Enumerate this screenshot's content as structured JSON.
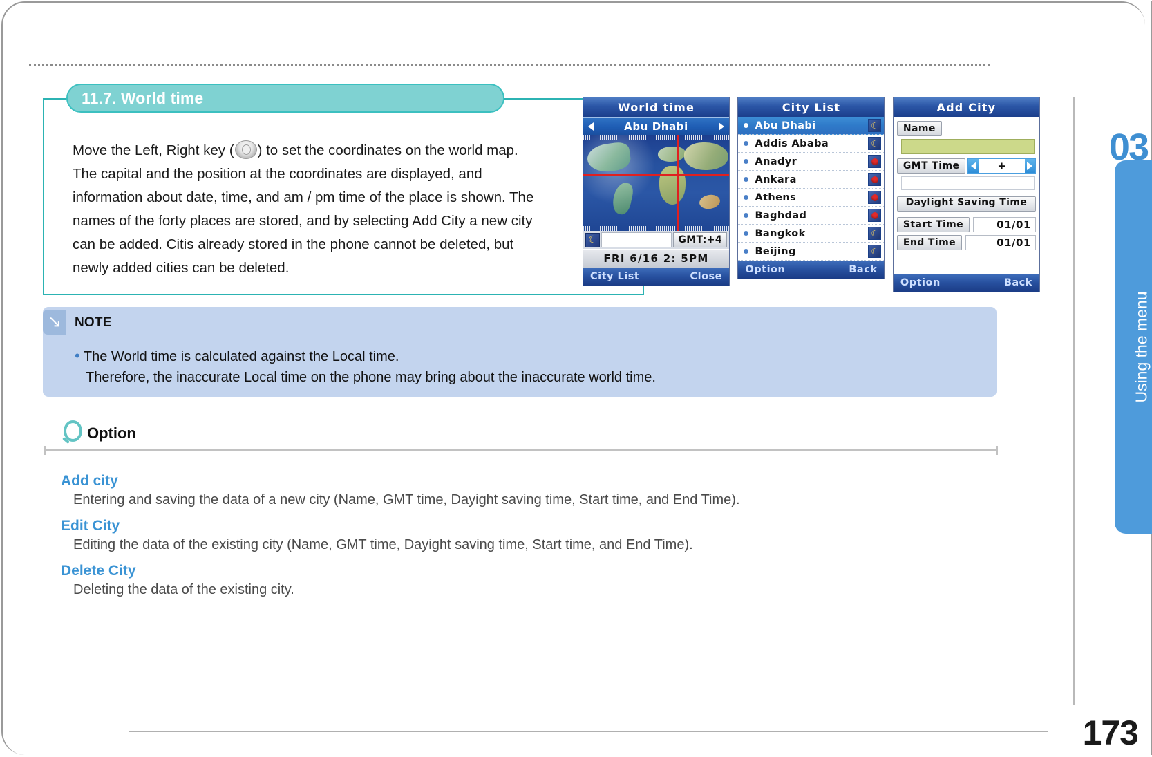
{
  "section": {
    "title": "11.7. World time",
    "body_before_key": "Move the Left, Right key (",
    "body_after_key": ") to set the coordinates on the world map. The capital and the position at the coordinates are displayed, and information about date, time, and am / pm time of the place is shown. The names of the forty places are stored, and by selecting Add City a new city can be added. Citis already stored in the phone cannot be deleted, but newly added cities can be deleted."
  },
  "screens": {
    "world_time": {
      "title": "World  time",
      "city": "Abu  Dhabi",
      "gmt": "GMT:+4",
      "date_line": "FRI   6/16   2: 5PM",
      "softkey_left": "City List",
      "softkey_right": "Close"
    },
    "city_list": {
      "title": "City  List",
      "items": [
        {
          "name": "Abu  Dhabi",
          "icon": "moon-icon",
          "selected": true
        },
        {
          "name": "Addis  Ababa",
          "icon": "moon-icon",
          "selected": false
        },
        {
          "name": "Anadyr",
          "icon": "sun-icon",
          "selected": false
        },
        {
          "name": "Ankara",
          "icon": "sun-icon",
          "selected": false
        },
        {
          "name": "Athens",
          "icon": "sun-icon",
          "selected": false
        },
        {
          "name": "Baghdad",
          "icon": "sun-icon",
          "selected": false
        },
        {
          "name": "Bangkok",
          "icon": "moon-icon",
          "selected": false
        },
        {
          "name": "Beijing",
          "icon": "moon-icon",
          "selected": false
        }
      ],
      "softkey_left": "Option",
      "softkey_right": "Back"
    },
    "add_city": {
      "title": "Add  City",
      "name_label": "Name",
      "name_value": "",
      "gmt_label": "GMT  Time",
      "gmt_value": "+",
      "dst_label": "Daylight  Saving  Time",
      "start_label": "Start  Time",
      "start_value": "01/01",
      "end_label": "End  Time",
      "end_value": "01/01",
      "softkey_left": "Option",
      "softkey_right": "Back"
    }
  },
  "note": {
    "label": "NOTE",
    "line1": "The World time is calculated against the Local time.",
    "line2": "Therefore, the inaccurate Local time on the phone may bring about the inaccurate world time."
  },
  "option": {
    "heading": "Option",
    "entries": [
      {
        "term": "Add city",
        "desc": "Entering and saving the data of a new city (Name, GMT time, Dayight saving time, Start time, and End Time)."
      },
      {
        "term": "Edit City",
        "desc": "Editing the data of the existing city (Name, GMT time, Dayight saving time, Start time, and End Time)."
      },
      {
        "term": "Delete City",
        "desc": "Deleting the data of the existing city."
      }
    ]
  },
  "rail": {
    "chapter_number": "03",
    "chapter_title": "Using the menu"
  },
  "page_number": "173"
}
